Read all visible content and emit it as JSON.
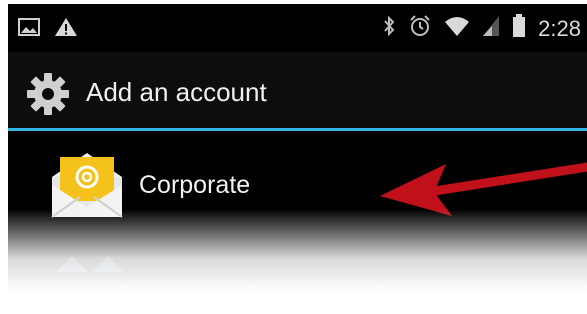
{
  "status_bar": {
    "time": "2:28",
    "icons": [
      "image-notification-icon",
      "warning-icon",
      "bluetooth-icon",
      "alarm-icon",
      "wifi-icon",
      "signal-icon",
      "battery-icon"
    ]
  },
  "action_bar": {
    "title": "Add an account",
    "icon": "settings-gear-icon"
  },
  "accounts": [
    {
      "label": "Corporate",
      "icon": "email-envelope-icon"
    }
  ],
  "colors": {
    "background": "#000000",
    "accent_divider": "#33b5e5",
    "envelope_yellow": "#f5c21b",
    "arrow_red": "#c0101a"
  }
}
